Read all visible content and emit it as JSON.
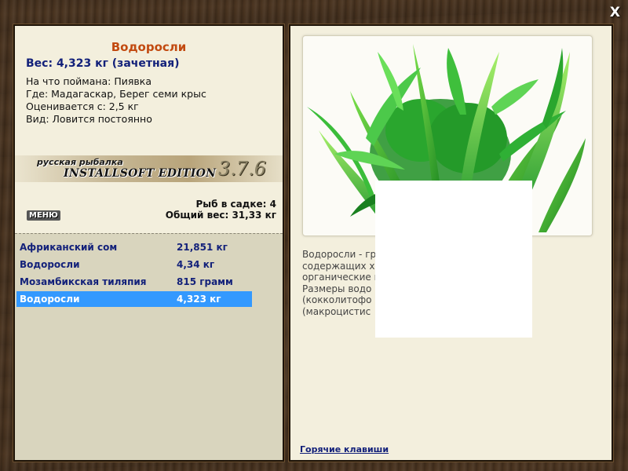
{
  "window": {
    "close_label": "X"
  },
  "fish": {
    "title": "Водоросли",
    "weight": "Вес: 4,323 кг (зачетная)",
    "caught_on": "На что поймана: Пиявка",
    "location": "Где: Мадагаскар, Берег семи крыс",
    "value_from": "Оценивается с: 2,5 кг",
    "kind": "Вид: Ловится постоянно"
  },
  "banner": {
    "top": "русская рыбалка",
    "main": "INSTALLSOFT EDITION",
    "version": "3.7.6"
  },
  "menu_label": "МЕНЮ",
  "keep": {
    "count": "Рыб в садке: 4",
    "total": "Общий вес: 31,33 кг"
  },
  "catch_list": [
    {
      "name": "Африканский сом",
      "weight": "21,851 кг",
      "selected": false
    },
    {
      "name": "Водоросли",
      "weight": "4,34 кг",
      "selected": false
    },
    {
      "name": "Мозамбикская тиляпия",
      "weight": "815 грамм",
      "selected": false
    },
    {
      "name": "Водоросли",
      "weight": "4,323 кг",
      "selected": true
    }
  ],
  "description_lines": [
    "Водоросли - гр                                              й, обычно",
    "содержащих х                                               :",
    "органические                                               нтеза.",
    "Размеры водо                                              икрона",
    "(кокколитофо                                              до 40 м",
    "(макроцистис"
  ],
  "hotkeys_label": "Горячие клавиши",
  "colors": {
    "title": "#c24a10",
    "link": "#13217a",
    "selected_row": "#3399ff",
    "panel_bg": "#f3efdd"
  }
}
